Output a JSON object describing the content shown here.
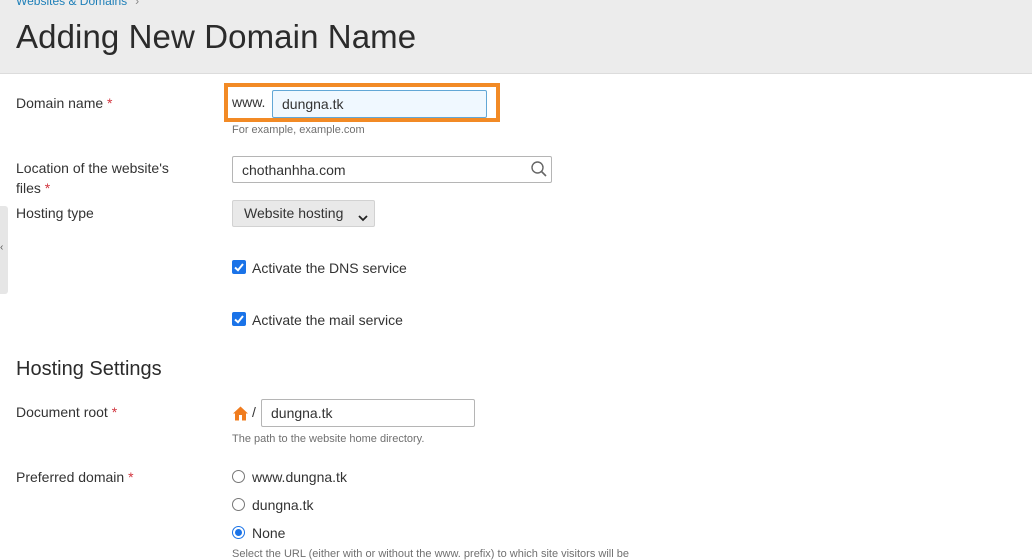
{
  "header": {
    "breadcrumb": "Websites & Domains",
    "breadcrumb_separator": "›",
    "title": "Adding New Domain Name"
  },
  "form": {
    "domain_name": {
      "label": "Domain name",
      "required_mark": "*",
      "prefix": "www.",
      "value": "dungna.tk",
      "hint": "For example, example.com"
    },
    "location": {
      "label_line1": "Location of the website's",
      "label_line2": "files",
      "required_mark": "*",
      "value": "chothanhha.com",
      "icon": "search-icon"
    },
    "hosting_type": {
      "label": "Hosting type",
      "selected": "Website hosting"
    },
    "activate_dns": {
      "label": "Activate the DNS service",
      "checked": true
    },
    "activate_mail": {
      "label": "Activate the mail service",
      "checked": true
    }
  },
  "hosting_settings": {
    "title": "Hosting Settings",
    "document_root": {
      "label": "Document root",
      "required_mark": "*",
      "icon": "home-icon",
      "slash": "/",
      "value": "dungna.tk",
      "hint": "The path to the website home directory."
    },
    "preferred_domain": {
      "label": "Preferred domain",
      "required_mark": "*",
      "options": [
        "www.dungna.tk",
        "dungna.tk",
        "None"
      ],
      "selected": "None",
      "hint": "Select the URL (either with or without the www. prefix) to which site visitors will be"
    }
  },
  "colors": {
    "highlight": "#f28a25",
    "accent": "#1a73e8",
    "link": "#1e7fb8",
    "required": "#d2353f"
  }
}
